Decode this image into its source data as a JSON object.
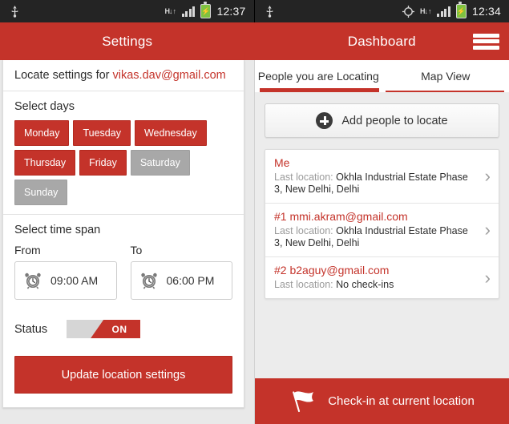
{
  "status_bar": {
    "left": {
      "usb_icon": "usb-icon",
      "network": "H",
      "network_arrows": "↓↑",
      "battery_icon": "battery-charging-icon",
      "signal_icon": "signal-bars-icon",
      "time": "12:37"
    },
    "right": {
      "usb_icon": "usb-icon",
      "gps_icon": "gps-crosshair-icon",
      "network": "H",
      "network_arrows": "↓↑",
      "battery_icon": "battery-charging-icon",
      "signal_icon": "signal-bars-icon",
      "time": "12:34"
    }
  },
  "left_app_bar": {
    "title": "Settings"
  },
  "right_app_bar": {
    "title": "Dashboard",
    "menu_icon": "hamburger-menu-icon"
  },
  "settings": {
    "locate_prefix": "Locate settings for ",
    "account_email": "vikas.dav@gmail.com",
    "select_days_label": "Select days",
    "days": [
      {
        "label": "Monday",
        "selected": true
      },
      {
        "label": "Tuesday",
        "selected": true
      },
      {
        "label": "Wednesday",
        "selected": true
      },
      {
        "label": "Thursday",
        "selected": true
      },
      {
        "label": "Friday",
        "selected": true
      },
      {
        "label": "Saturday",
        "selected": false
      },
      {
        "label": "Sunday",
        "selected": false
      }
    ],
    "time_span_label": "Select time span",
    "from_label": "From",
    "from_value": "09:00 AM",
    "to_label": "To",
    "to_value": "06:00 PM",
    "clock_icon": "alarm-clock-icon",
    "status_label": "Status",
    "status_toggle_value": "ON",
    "update_button_label": "Update location settings"
  },
  "dashboard": {
    "tabs": [
      {
        "label": "People you are Locating",
        "active": true
      },
      {
        "label": "Map View",
        "active": false
      }
    ],
    "add_button_label": "Add people to locate",
    "add_button_icon": "plus-circle-icon",
    "chevron_icon": "chevron-right-icon",
    "people": [
      {
        "name": "Me",
        "loc_label": "Last location: ",
        "loc_value": "Okhla Industrial Estate Phase 3, New Delhi, Delhi"
      },
      {
        "name": "#1 mmi.akram@gmail.com",
        "loc_label": "Last location: ",
        "loc_value": "Okhla Industrial Estate Phase 3, New Delhi, Delhi"
      },
      {
        "name": "#2 b2aguy@gmail.com",
        "loc_label": "Last location: ",
        "loc_value": "No check-ins"
      }
    ],
    "checkin_label": "Check-in at current location",
    "checkin_icon": "flag-icon"
  },
  "colors": {
    "brand_red": "#c4332a",
    "brand_red_dark": "#b3291f",
    "status_bar": "#242424",
    "gray_button": "#a8a8a8"
  }
}
